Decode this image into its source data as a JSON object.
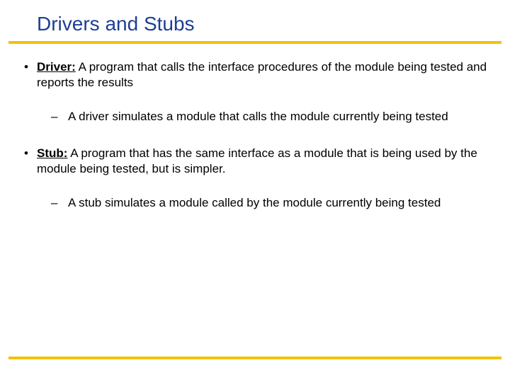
{
  "title": "Drivers and Stubs",
  "bullets": [
    {
      "term": "Driver:",
      "text": " A program that calls the interface procedures of the module being tested and reports the results",
      "sub": "A driver simulates a module that calls the module currently being tested"
    },
    {
      "term": "Stub:",
      "text": " A program that has the same interface as a module that is being used by the module being tested,  but is simpler.",
      "sub": "A stub simulates a module called by the module currently being tested"
    }
  ]
}
